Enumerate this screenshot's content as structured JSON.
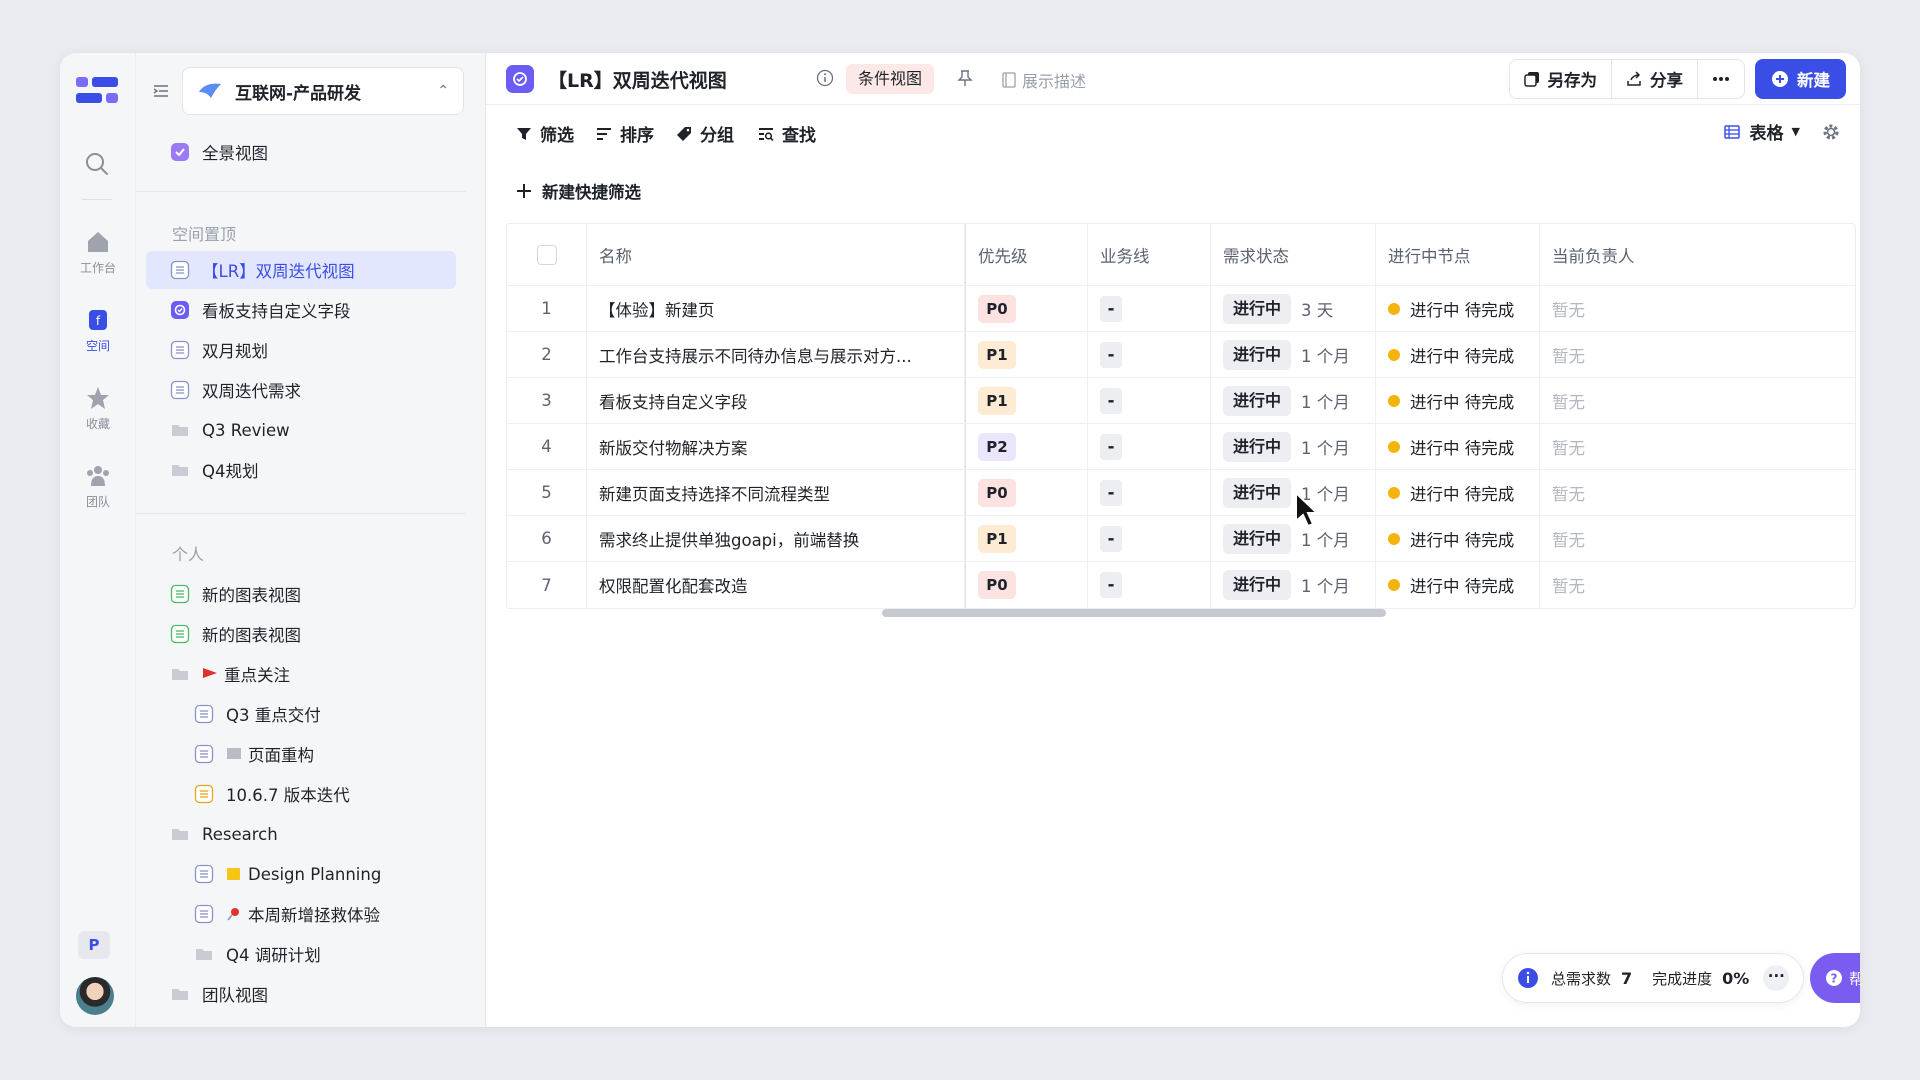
{
  "rail": {
    "items": [
      {
        "label": "工作台",
        "icon": "home-icon"
      },
      {
        "label": "空间",
        "icon": "space-icon"
      },
      {
        "label": "收藏",
        "icon": "star-icon"
      },
      {
        "label": "团队",
        "icon": "team-icon"
      }
    ],
    "user_initial": "P",
    "accent": "#3a4ee6"
  },
  "sidebar": {
    "workspace_name": "互联网-产品研发",
    "top_item": "全景视图",
    "section_pinned": "空间置顶",
    "pinned": [
      {
        "label": "【LR】双周迭代视图",
        "active": true
      },
      {
        "label": "看板支持自定义字段"
      },
      {
        "label": "双月规划"
      },
      {
        "label": "双周迭代需求"
      },
      {
        "label": "Q3 Review"
      },
      {
        "label": "Q4规划"
      }
    ],
    "section_personal": "个人",
    "personal": [
      {
        "label": "新的图表视图"
      },
      {
        "label": "新的图表视图"
      },
      {
        "label": "重点关注"
      },
      {
        "label": "Q3 重点交付"
      },
      {
        "label": "页面重构"
      },
      {
        "label": "10.6.7 版本迭代"
      },
      {
        "label": "Research"
      },
      {
        "label": "Design Planning"
      },
      {
        "label": "本周新增拯救体验"
      },
      {
        "label": "Q4 调研计划"
      },
      {
        "label": "团队视图"
      }
    ]
  },
  "header": {
    "title": "【LR】双周迭代视图",
    "condition_badge": "条件视图",
    "show_desc": "展示描述",
    "save_as": "另存为",
    "share": "分享",
    "new": "新建"
  },
  "toolbar": {
    "filter": "筛选",
    "sort": "排序",
    "group": "分组",
    "find": "查找",
    "view_mode": "表格",
    "quick_filter": "新建快捷筛选"
  },
  "table": {
    "columns": [
      "名称",
      "优先级",
      "业务线",
      "需求状态",
      "进行中节点",
      "当前负责人"
    ],
    "rows": [
      {
        "no": "1",
        "name": "【体验】新建页",
        "priority": "P0",
        "biz": "-",
        "status": "进行中",
        "duration": "3 天",
        "node": "进行中 待完成",
        "owner": "暂无"
      },
      {
        "no": "2",
        "name": "工作台支持展示不同待办信息与展示对方...",
        "priority": "P1",
        "biz": "-",
        "status": "进行中",
        "duration": "1 个月",
        "node": "进行中 待完成",
        "owner": "暂无"
      },
      {
        "no": "3",
        "name": "看板支持自定义字段",
        "priority": "P1",
        "biz": "-",
        "status": "进行中",
        "duration": "1 个月",
        "node": "进行中 待完成",
        "owner": "暂无"
      },
      {
        "no": "4",
        "name": "新版交付物解决方案",
        "priority": "P2",
        "biz": "-",
        "status": "进行中",
        "duration": "1 个月",
        "node": "进行中 待完成",
        "owner": "暂无"
      },
      {
        "no": "5",
        "name": "新建页面支持选择不同流程类型",
        "priority": "P0",
        "biz": "-",
        "status": "进行中",
        "duration": "1 个月",
        "node": "进行中 待完成",
        "owner": "暂无"
      },
      {
        "no": "6",
        "name": "需求终止提供单独goapi，前端替换",
        "priority": "P1",
        "biz": "-",
        "status": "进行中",
        "duration": "1 个月",
        "node": "进行中 待完成",
        "owner": "暂无"
      },
      {
        "no": "7",
        "name": "权限配置化配套改造",
        "priority": "P0",
        "biz": "-",
        "status": "进行中",
        "duration": "1 个月",
        "node": "进行中 待完成",
        "owner": "暂无"
      }
    ],
    "priority_colors": {
      "P0": "#fde2e2",
      "P1": "#fdebd3",
      "P2": "#ece6fd"
    },
    "node_dot_color": "#f5b40c"
  },
  "footer": {
    "total_label": "总需求数",
    "total_value": "7",
    "progress_label": "完成进度",
    "progress_value": "0%",
    "help": "帮助"
  }
}
